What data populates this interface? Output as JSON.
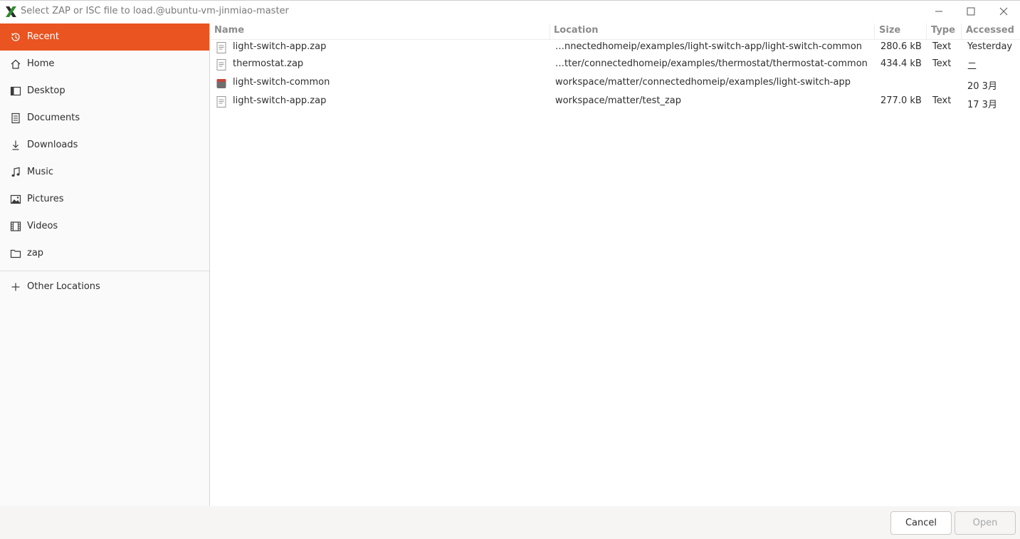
{
  "window": {
    "title": "Select ZAP or ISC file to load.@ubuntu-vm-jinmiao-master",
    "app_icon": "x-app-icon"
  },
  "sidebar": {
    "items": [
      {
        "label": "Recent",
        "icon": "clock-icon",
        "active": true
      },
      {
        "label": "Home",
        "icon": "home-icon"
      },
      {
        "label": "Desktop",
        "icon": "desktop-icon"
      },
      {
        "label": "Documents",
        "icon": "document-icon"
      },
      {
        "label": "Downloads",
        "icon": "download-icon"
      },
      {
        "label": "Music",
        "icon": "music-icon"
      },
      {
        "label": "Pictures",
        "icon": "picture-icon"
      },
      {
        "label": "Videos",
        "icon": "video-icon"
      },
      {
        "label": "zap",
        "icon": "folder-icon"
      }
    ],
    "other": {
      "label": "Other Locations",
      "icon": "plus-icon"
    }
  },
  "columns": {
    "name": "Name",
    "location": "Location",
    "size": "Size",
    "type": "Type",
    "accessed": "Accessed"
  },
  "rows": [
    {
      "icon": "text-file-icon",
      "name": "light-switch-app.zap",
      "location": "…nnectedhomeip/examples/light-switch-app/light-switch-common",
      "size": "280.6 kB",
      "type": "Text",
      "accessed": "Yesterday"
    },
    {
      "icon": "text-file-icon",
      "name": "thermostat.zap",
      "location": "…tter/connectedhomeip/examples/thermostat/thermostat-common",
      "size": "434.4 kB",
      "type": "Text",
      "accessed": "二"
    },
    {
      "icon": "folder-icon",
      "name": "light-switch-common",
      "location": "workspace/matter/connectedhomeip/examples/light-switch-app",
      "size": "",
      "type": "",
      "accessed": "20 3月"
    },
    {
      "icon": "text-file-icon",
      "name": "light-switch-app.zap",
      "location": "workspace/matter/test_zap",
      "size": "277.0 kB",
      "type": "Text",
      "accessed": "17 3月"
    }
  ],
  "buttons": {
    "cancel": "Cancel",
    "open": "Open"
  },
  "colors": {
    "accent": "#e95420"
  }
}
